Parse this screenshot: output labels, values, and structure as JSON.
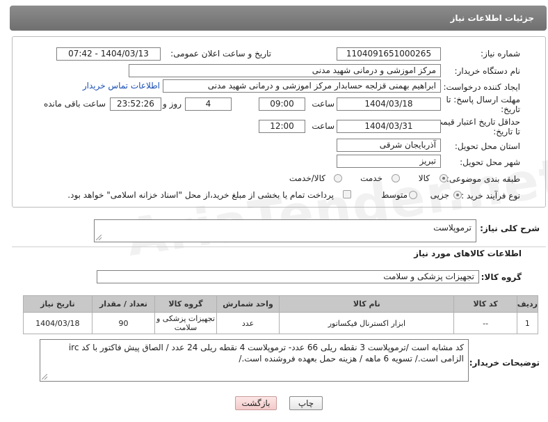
{
  "header": {
    "title": "جزئیات اطلاعات نیاز"
  },
  "fields": {
    "need_number_label": "شماره نیاز:",
    "need_number": "1104091651000265",
    "announce_label": "تاریخ و ساعت اعلان عمومی:",
    "announce_value": "1404/03/13 - 07:42",
    "buyer_org_label": "نام دستگاه خریدار:",
    "buyer_org": "مرکز اموزشی و درمانی شهید مدنی",
    "creator_label": "ایجاد کننده درخواست:",
    "creator": "ابراهیم بهمنی قزلجه حسابدار مرکز اموزشی و درمانی شهید مدنی",
    "contact_link": "اطلاعات تماس خریدار",
    "reply_deadline_label_1": "مهلت ارسال پاسخ: تا",
    "reply_deadline_label_2": "تاریخ:",
    "reply_date": "1404/03/18",
    "time_label": "ساعت",
    "reply_time": "09:00",
    "days_value": "4",
    "days_label": "روز و",
    "remaining_value": "23:52:26",
    "remaining_label": "ساعت باقی مانده",
    "price_deadline_label_1": "حداقل تاریخ اعتبار قیمت:",
    "price_deadline_label_2": "تا تاریخ:",
    "price_date": "1404/03/31",
    "price_time": "12:00",
    "province_label": "استان محل تحویل:",
    "province": "آذربایجان شرقی",
    "city_label": "شهر محل تحویل:",
    "city": "تبریز",
    "category_label": "طبقه بندی موضوعی:",
    "category_options": [
      "کالا",
      "خدمت",
      "کالا/خدمت"
    ],
    "purchase_label": "نوع فرآیند خرید :",
    "purchase_options": [
      "جزیی",
      "متوسط"
    ],
    "payment_note": "پرداخت تمام یا بخشی از مبلغ خرید،از محل \"اسناد خزانه اسلامی\" خواهد بود."
  },
  "summary": {
    "label": "شرح کلی نیاز:",
    "value": "ترموپلاست"
  },
  "goods_section": {
    "title": "اطلاعات کالاهای مورد نیاز",
    "group_label": "گروه کالا:",
    "group_value": "تجهیزات پزشکی و سلامت"
  },
  "table": {
    "headers": [
      "ردیف",
      "کد کالا",
      "نام کالا",
      "واحد شمارش",
      "گروه کالا",
      "تعداد / مقدار",
      "تاریخ نیاز"
    ],
    "rows": [
      {
        "row": "1",
        "code": "--",
        "name": "ابزار اکسترنال فیکساتور",
        "unit": "عدد",
        "group": "تجهیزات پزشکی و سلامت",
        "qty": "90",
        "date": "1404/03/18"
      }
    ]
  },
  "buyer_notes": {
    "label": "توضیحات خریدار:",
    "value": "کد مشابه است /ترموپلاست 3 نقطه ریلی 66 عدد- ترموپلاست 4 نقطه ریلی 24 عدد / الصاق پیش فاکتور با کد irc الزامی است./ تسویه 6 ماهه / هزینه حمل بعهده فروشنده است./"
  },
  "buttons": {
    "print": "چاپ",
    "back": "بازگشت"
  },
  "watermark": {
    "text": "AriaTender.net"
  }
}
